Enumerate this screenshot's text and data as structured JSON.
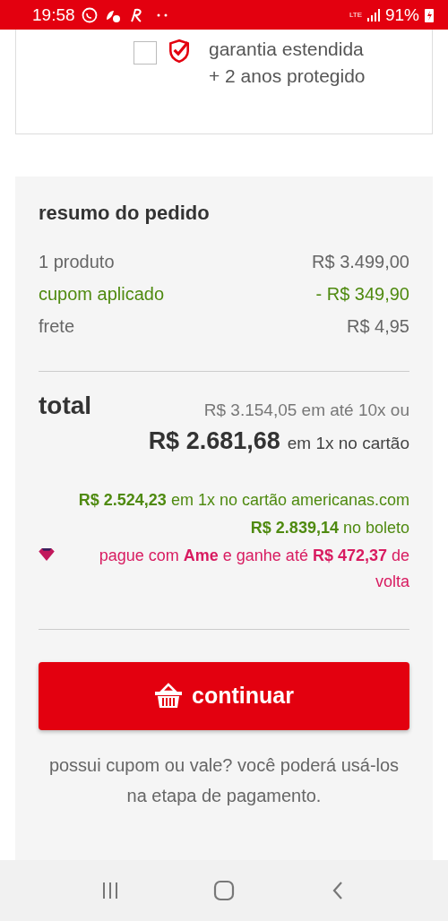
{
  "status_bar": {
    "time": "19:58",
    "network": "LTE",
    "battery": "91%"
  },
  "warranty": {
    "checked": false,
    "title": "garantia estendida",
    "subtitle": "+ 2 anos protegido"
  },
  "summary": {
    "title": "resumo do pedido",
    "rows": [
      {
        "label": "1 produto",
        "value": "R$ 3.499,00",
        "kind": "normal"
      },
      {
        "label": "cupom aplicado",
        "value": "- R$ 349,90",
        "kind": "discount"
      },
      {
        "label": "frete",
        "value": "R$ 4,95",
        "kind": "normal"
      }
    ],
    "total": {
      "label": "total",
      "installments": "R$ 3.154,05 em até 10x ou",
      "price": "R$ 2.681,68",
      "price_note": "em 1x no cartão"
    },
    "offers": [
      {
        "text": "**R$ 2.524,23** em 1x no cartão americanas.com",
        "kind": "green"
      },
      {
        "text": "**R$ 2.839,14** no boleto",
        "kind": "green"
      },
      {
        "text": "pague com **Ame** e ganhe até **R$ 472,37** de volta",
        "kind": "ame"
      }
    ],
    "button": "continuar",
    "note": "possui cupom ou vale? você poderá usá-los na etapa de pagamento."
  }
}
